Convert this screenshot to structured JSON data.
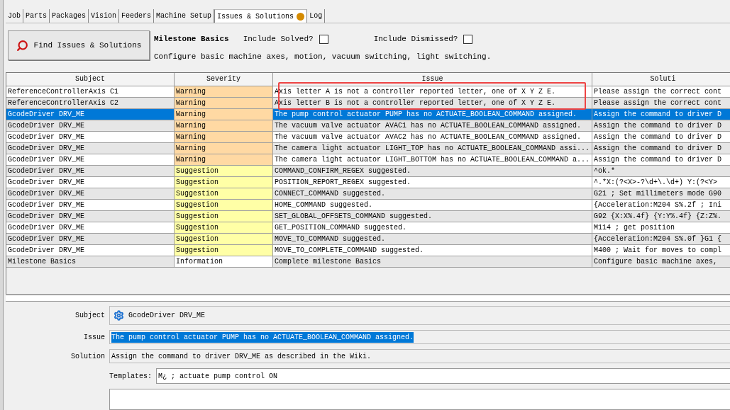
{
  "tabs": [
    {
      "label": "Job",
      "selected": false
    },
    {
      "label": "Parts",
      "selected": false
    },
    {
      "label": "Packages",
      "selected": false
    },
    {
      "label": "Vision",
      "selected": false
    },
    {
      "label": "Feeders",
      "selected": false
    },
    {
      "label": "Machine Setup",
      "selected": false
    },
    {
      "label": "Issues & Solutions",
      "selected": true,
      "color": "#d48a00"
    },
    {
      "label": "Log",
      "selected": false
    }
  ],
  "toolbar": {
    "find_button": "Find Issues & Solutions",
    "milestone": "Milestone Basics",
    "include_solved": {
      "label": "Include Solved?",
      "checked": false
    },
    "include_dismissed": {
      "label": "Include Dismissed?",
      "checked": false
    },
    "description": "Configure basic machine axes, motion, vacuum switching, light switching."
  },
  "table": {
    "columns": [
      "Subject",
      "Severity",
      "Issue",
      "Soluti"
    ],
    "rows": [
      {
        "subject": "ReferenceControllerAxis C1",
        "severity": "Warning",
        "kind": "warning",
        "issue": "Axis letter A is not a controller reported letter, one of X Y Z E.",
        "solution": "Please assign the correct cont",
        "selected": false
      },
      {
        "subject": "ReferenceControllerAxis C2",
        "severity": "Warning",
        "kind": "warning",
        "issue": "Axis letter B is not a controller reported letter, one of X Y Z E.",
        "solution": "Please assign the correct cont",
        "selected": false
      },
      {
        "subject": "GcodeDriver DRV_ME",
        "severity": "Warning",
        "kind": "warning",
        "issue": "The pump control actuator PUMP has no ACTUATE_BOOLEAN_COMMAND assigned.",
        "solution": "Assign the command to driver D",
        "selected": true
      },
      {
        "subject": "GcodeDriver DRV_ME",
        "severity": "Warning",
        "kind": "warning",
        "issue": "The vacuum valve actuator AVAC1 has no ACTUATE_BOOLEAN_COMMAND assigned.",
        "solution": "Assign the command to driver D",
        "selected": false
      },
      {
        "subject": "GcodeDriver DRV_ME",
        "severity": "Warning",
        "kind": "warning",
        "issue": "The vacuum valve actuator AVAC2 has no ACTUATE_BOOLEAN_COMMAND assigned.",
        "solution": "Assign the command to driver D",
        "selected": false
      },
      {
        "subject": "GcodeDriver DRV_ME",
        "severity": "Warning",
        "kind": "warning",
        "issue": "The camera light actuator LIGHT_TOP has no ACTUATE_BOOLEAN_COMMAND assi...",
        "solution": "Assign the command to driver D",
        "selected": false
      },
      {
        "subject": "GcodeDriver DRV_ME",
        "severity": "Warning",
        "kind": "warning",
        "issue": "The camera light actuator LIGHT_BOTTOM has no ACTUATE_BOOLEAN_COMMAND a...",
        "solution": "Assign the command to driver D",
        "selected": false
      },
      {
        "subject": "GcodeDriver DRV_ME",
        "severity": "Suggestion",
        "kind": "suggestion",
        "issue": "COMMAND_CONFIRM_REGEX suggested.",
        "solution": "^ok.*",
        "selected": false
      },
      {
        "subject": "GcodeDriver DRV_ME",
        "severity": "Suggestion",
        "kind": "suggestion",
        "issue": "POSITION_REPORT_REGEX suggested.",
        "solution": "^.*X:(?<X>-?\\d+\\.\\d+) Y:(?<Y>",
        "selected": false
      },
      {
        "subject": "GcodeDriver DRV_ME",
        "severity": "Suggestion",
        "kind": "suggestion",
        "issue": "CONNECT_COMMAND suggested.",
        "solution": "G21 ; Set millimeters mode G90",
        "selected": false
      },
      {
        "subject": "GcodeDriver DRV_ME",
        "severity": "Suggestion",
        "kind": "suggestion",
        "issue": "HOME_COMMAND suggested.",
        "solution": "{Acceleration:M204 S%.2f ; Ini",
        "selected": false
      },
      {
        "subject": "GcodeDriver DRV_ME",
        "severity": "Suggestion",
        "kind": "suggestion",
        "issue": "SET_GLOBAL_OFFSETS_COMMAND suggested.",
        "solution": "G92 {X:X%.4f} {Y:Y%.4f} {Z:Z%.",
        "selected": false
      },
      {
        "subject": "GcodeDriver DRV_ME",
        "severity": "Suggestion",
        "kind": "suggestion",
        "issue": "GET_POSITION_COMMAND suggested.",
        "solution": "M114 ; get position",
        "selected": false
      },
      {
        "subject": "GcodeDriver DRV_ME",
        "severity": "Suggestion",
        "kind": "suggestion",
        "issue": "MOVE_TO_COMMAND suggested.",
        "solution": "{Acceleration:M204 S%.0f }G1 {",
        "selected": false
      },
      {
        "subject": "GcodeDriver DRV_ME",
        "severity": "Suggestion",
        "kind": "suggestion",
        "issue": "MOVE_TO_COMPLETE_COMMAND suggested.",
        "solution": "M400 ; Wait for moves to compl",
        "selected": false
      },
      {
        "subject": "Milestone Basics",
        "severity": "Information",
        "kind": "information",
        "issue": "Complete milestone Basics",
        "solution": "Configure basic machine axes,",
        "selected": false
      }
    ]
  },
  "details": {
    "subject_label": "Subject",
    "subject": "GcodeDriver DRV_ME",
    "issue_label": "Issue",
    "issue": "The pump control actuator PUMP has no ACTUATE_BOOLEAN_COMMAND assigned.",
    "solution_label": "Solution",
    "solution": "Assign the command to driver DRV_ME as described in the Wiki.",
    "templates_label": "Templates:",
    "templates": "M¿ ; actuate pump control ON"
  }
}
